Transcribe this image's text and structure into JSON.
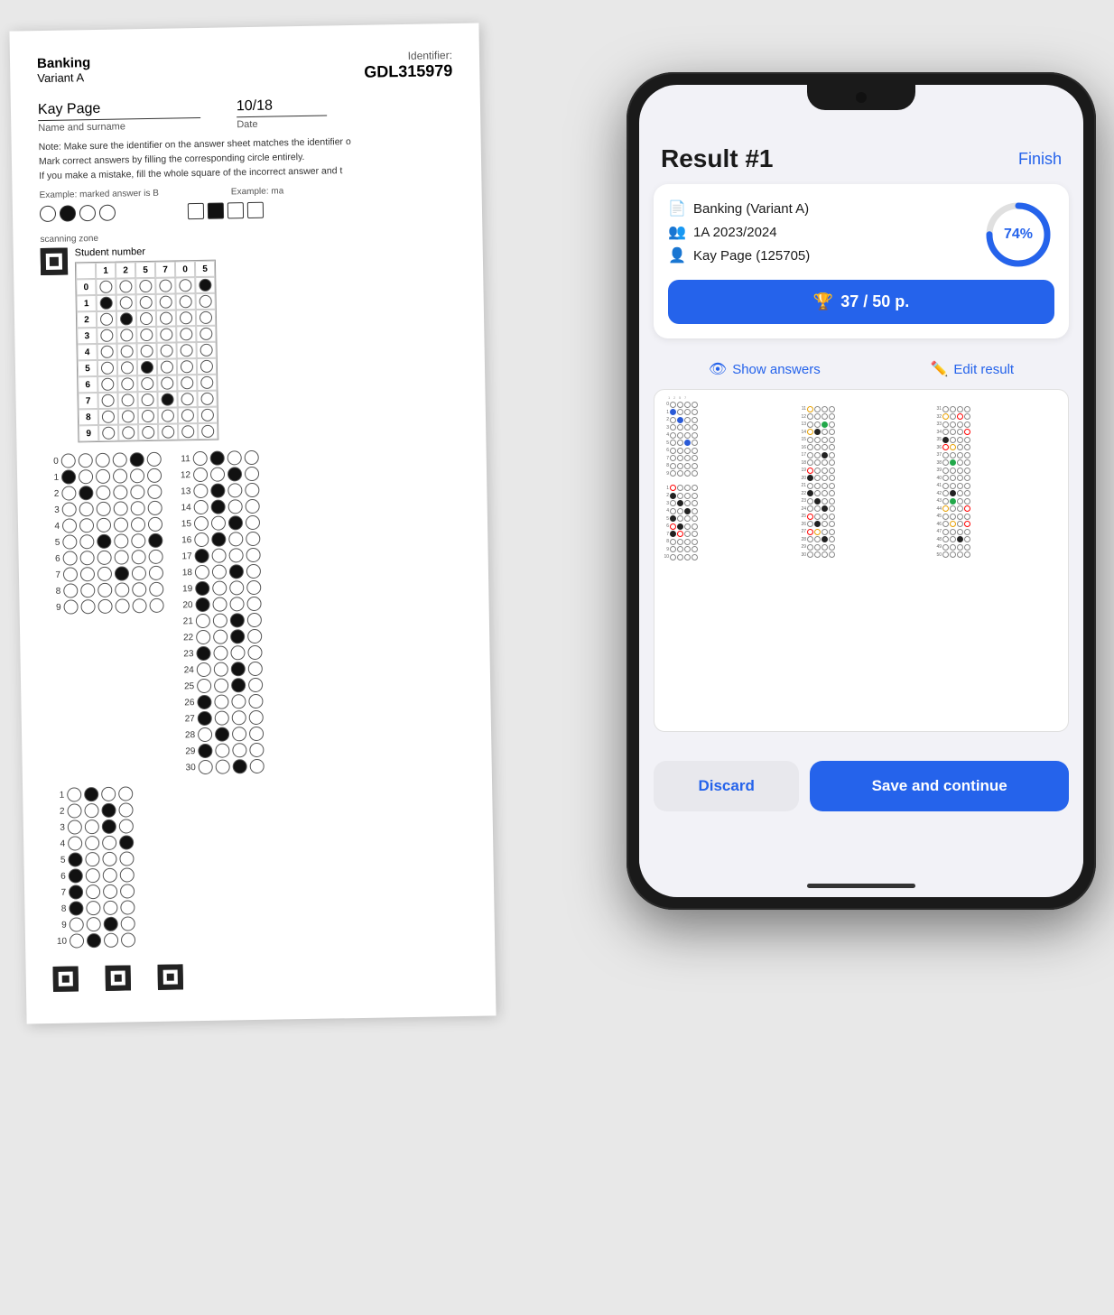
{
  "sheet": {
    "title": "Banking",
    "variant": "Variant A",
    "id_label": "Identifier:",
    "id_value": "GDL315979",
    "name_value": "Kay Page",
    "name_label": "Name and surname",
    "date_value": "10/18",
    "date_label": "Date",
    "note": "Note: Make sure the identifier on the answer sheet matches the identifier on the answer sheet. Mark correct answers by filling the corresponding circle entirely. If you make a mistake, fill the whole square of the incorrect answer and the",
    "example1": "Example: marked answer is B",
    "example2": "Example: ma",
    "scanning_zone": "scanning zone",
    "student_number_label": "Student number",
    "student_digits": [
      "1",
      "2",
      "5",
      "7",
      "0",
      "5"
    ]
  },
  "app": {
    "title": "Result #1",
    "finish_label": "Finish",
    "subject": "Banking (Variant A)",
    "class": "1A 2023/2024",
    "student": "Kay Page (125705)",
    "percent": "74%",
    "score": "37 / 50 p.",
    "show_answers": "Show answers",
    "edit_result": "Edit result",
    "discard_label": "Discard",
    "save_label": "Save and continue"
  },
  "icons": {
    "document": "🗎",
    "group": "👥",
    "person": "👤",
    "trophy": "🏆",
    "eye": "👁",
    "pencil": "✏️"
  }
}
